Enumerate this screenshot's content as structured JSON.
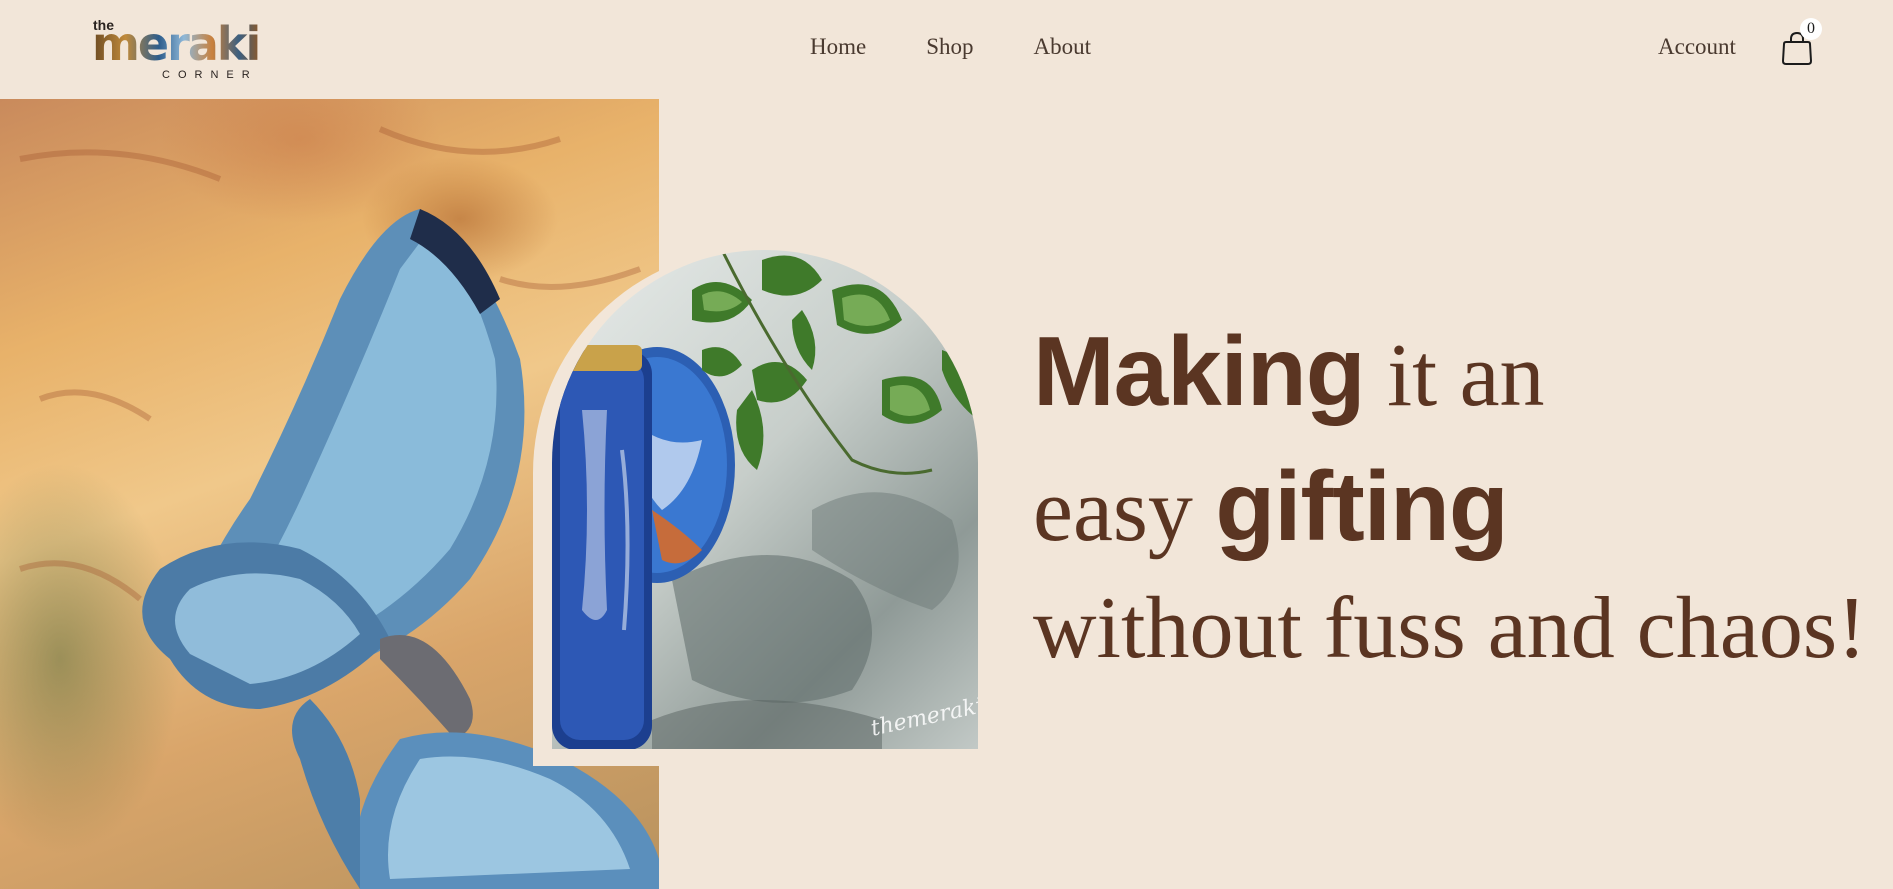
{
  "brand": {
    "logo_the": "the",
    "logo_word": "meraki",
    "logo_sub": "CORNER"
  },
  "nav": {
    "items": [
      {
        "label": "Home"
      },
      {
        "label": "Shop"
      },
      {
        "label": "About"
      }
    ],
    "account_label": "Account",
    "cart_count": "0"
  },
  "hero": {
    "line1_bold": "Making",
    "line1_rest": " it an",
    "line2_start": "easy ",
    "line2_bold": "gifting",
    "line3": "without fuss and chaos!",
    "signature": "themeraki"
  },
  "colors": {
    "background": "#f2e6d9",
    "headline": "#5b3522",
    "nav_text": "#4a3a30"
  }
}
